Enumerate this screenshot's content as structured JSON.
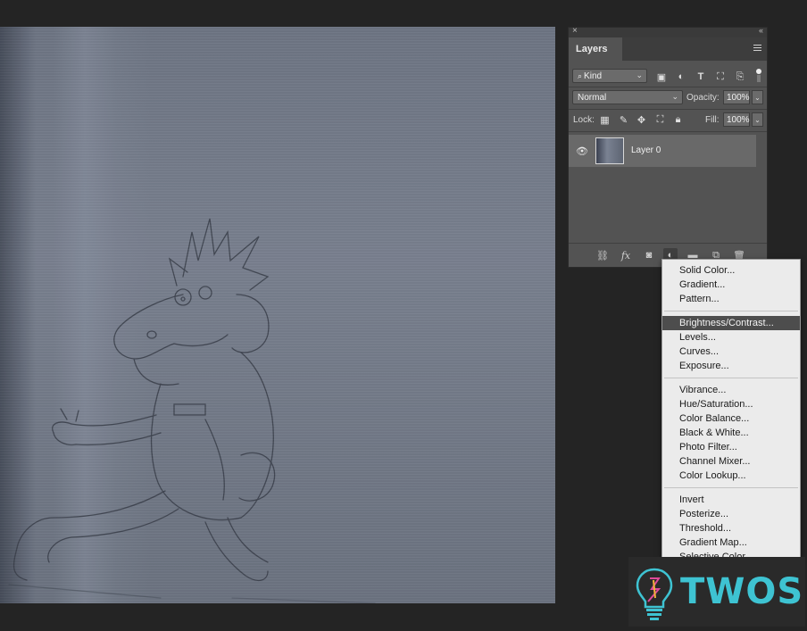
{
  "layers_panel": {
    "tab_label": "Layers",
    "close_glyph": "×",
    "collapse_glyph": "‹‹",
    "filter": {
      "kind_label": "Kind",
      "filter_icons": [
        "image-filter-icon",
        "adjustment-filter-icon",
        "type-filter-icon",
        "shape-filter-icon",
        "smart-object-filter-icon"
      ]
    },
    "blend_mode": "Normal",
    "opacity_label": "Opacity:",
    "opacity_value": "100%",
    "lock_label": "Lock:",
    "lock_icons": [
      "lock-transparent-icon",
      "lock-image-icon",
      "lock-position-icon",
      "lock-artboard-icon",
      "lock-all-icon"
    ],
    "fill_label": "Fill:",
    "fill_value": "100%",
    "layers": [
      {
        "name": "Layer 0",
        "visible": true
      }
    ],
    "bottom_icons": [
      "link-icon",
      "fx-icon",
      "mask-icon",
      "adjustment-layer-icon",
      "folder-icon",
      "new-layer-icon",
      "trash-icon"
    ],
    "fx_label": "fx"
  },
  "adjustment_menu": {
    "groups": [
      [
        "Solid Color...",
        "Gradient...",
        "Pattern..."
      ],
      [
        "Brightness/Contrast...",
        "Levels...",
        "Curves...",
        "Exposure..."
      ],
      [
        "Vibrance...",
        "Hue/Saturation...",
        "Color Balance...",
        "Black & White...",
        "Photo Filter...",
        "Channel Mixer...",
        "Color Lookup..."
      ],
      [
        "Invert",
        "Posterize...",
        "Threshold...",
        "Gradient Map...",
        "Selective Color..."
      ]
    ],
    "highlighted": "Brightness/Contrast..."
  },
  "watermark": {
    "text": "TWOS",
    "accent": "#3ec3d2"
  }
}
